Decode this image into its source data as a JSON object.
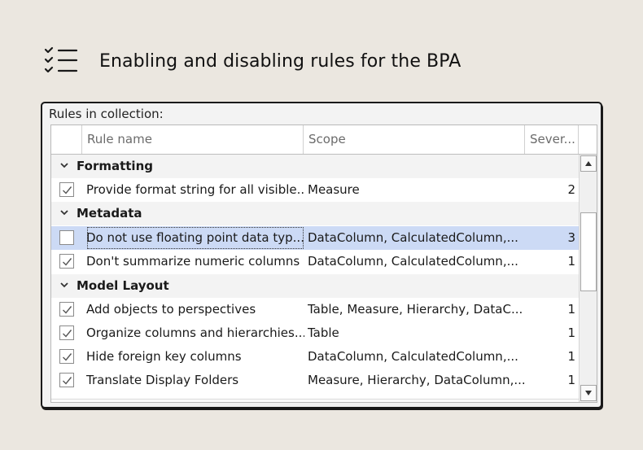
{
  "page": {
    "title": "Enabling and disabling rules for the BPA"
  },
  "dialog": {
    "collection_label": "Rules in collection:",
    "columns": {
      "name": "Rule name",
      "scope": "Scope",
      "severity": "Sever..."
    },
    "groups": [
      {
        "name": "Formatting",
        "rules": [
          {
            "checked": true,
            "name": "Provide format string for all visible...",
            "scope": "Measure",
            "severity": "2",
            "selected": false
          }
        ]
      },
      {
        "name": "Metadata",
        "rules": [
          {
            "checked": false,
            "name": "Do not use floating point data typ...",
            "scope": "DataColumn, CalculatedColumn,...",
            "severity": "3",
            "selected": true
          },
          {
            "checked": true,
            "name": "Don't summarize numeric columns",
            "scope": "DataColumn, CalculatedColumn,...",
            "severity": "1",
            "selected": false
          }
        ]
      },
      {
        "name": "Model Layout",
        "rules": [
          {
            "checked": true,
            "name": "Add objects to perspectives",
            "scope": "Table, Measure, Hierarchy, DataC...",
            "severity": "1",
            "selected": false
          },
          {
            "checked": true,
            "name": "Organize columns and hierarchies...",
            "scope": "Table",
            "severity": "1",
            "selected": false
          },
          {
            "checked": true,
            "name": "Hide foreign key columns",
            "scope": "DataColumn, CalculatedColumn,...",
            "severity": "1",
            "selected": false
          },
          {
            "checked": true,
            "name": "Translate Display Folders",
            "scope": "Measure, Hierarchy, DataColumn,...",
            "severity": "1",
            "selected": false
          }
        ]
      }
    ]
  },
  "colors": {
    "background": "#ebe7e0",
    "selected_row": "#ccdaf5",
    "group_row": "#f3f3f3"
  },
  "icons": {
    "header": "checklist-icon",
    "group_toggle": "chevron-down-icon",
    "row_check": "checkmark-icon",
    "scroll_up": "arrow-up-icon",
    "scroll_down": "arrow-down-icon"
  }
}
